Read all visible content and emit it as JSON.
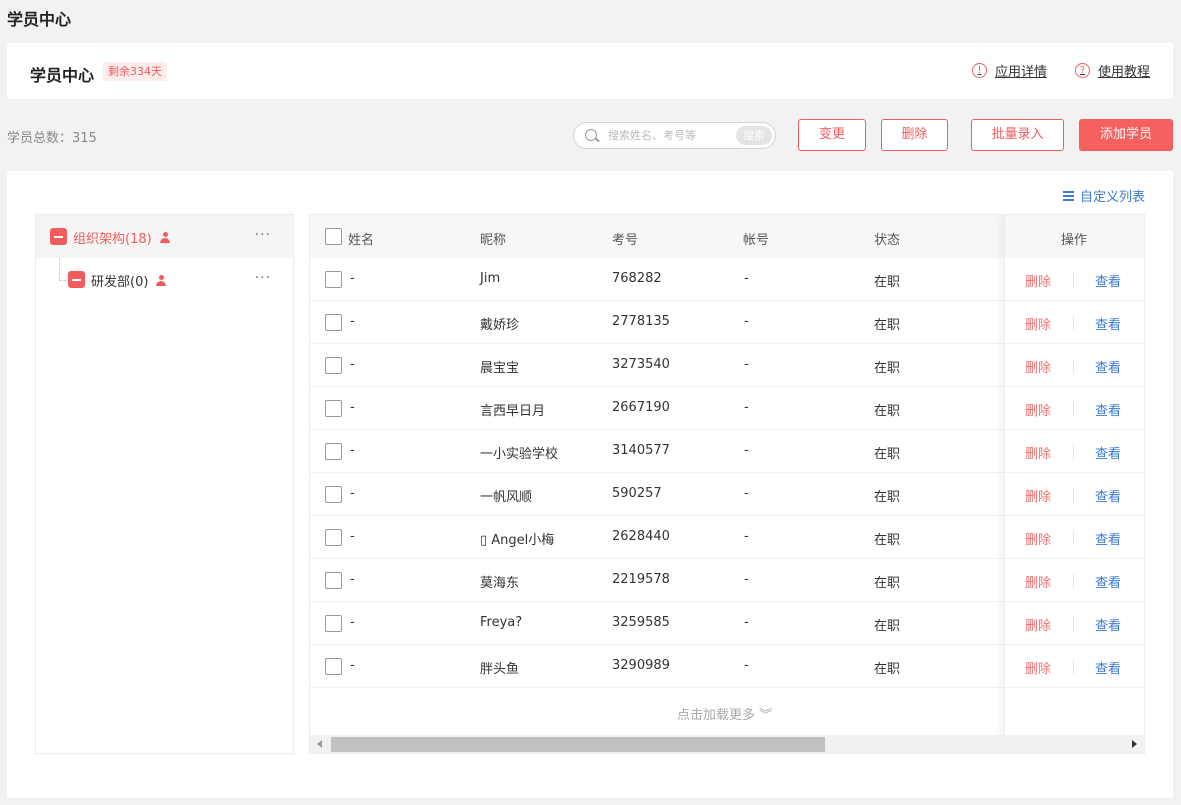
{
  "page": {
    "title": "学员中心"
  },
  "header": {
    "title": "学员中心",
    "remain_badge": "剩余334天",
    "app_detail": "应用详情",
    "tutorial": "使用教程"
  },
  "toolbar": {
    "total_text": "学员总数：315",
    "search_placeholder": "搜索姓名、考号等",
    "search_button": "搜索",
    "change": "变更",
    "delete": "删除",
    "batch_import": "批量录入",
    "add_student": "添加学员"
  },
  "custom_list": "自定义列表",
  "tree": {
    "root_label": "组织架构(18)",
    "child_label": "研发部(0)",
    "more": "···"
  },
  "table": {
    "columns": [
      "姓名",
      "昵称",
      "考号",
      "帐号",
      "状态",
      "操作"
    ],
    "rows": [
      {
        "name": "-",
        "nickname": "Jim",
        "exam_no": "768282",
        "account": "-",
        "status": "在职"
      },
      {
        "name": "-",
        "nickname": "戴娇珍",
        "exam_no": "2778135",
        "account": "-",
        "status": "在职"
      },
      {
        "name": "-",
        "nickname": "晨宝宝",
        "exam_no": "3273540",
        "account": "-",
        "status": "在职"
      },
      {
        "name": "-",
        "nickname": "言西早日月",
        "exam_no": "2667190",
        "account": "-",
        "status": "在职"
      },
      {
        "name": "-",
        "nickname": "一小实验学校",
        "exam_no": "3140577",
        "account": "-",
        "status": "在职"
      },
      {
        "name": "-",
        "nickname": "一帆风顺",
        "exam_no": "590257",
        "account": "-",
        "status": "在职"
      },
      {
        "name": "-",
        "nickname": "\u0000 Angel小梅",
        "exam_no": "2628440",
        "account": "-",
        "status": "在职"
      },
      {
        "name": "-",
        "nickname": "莫海东",
        "exam_no": "2219578",
        "account": "-",
        "status": "在职"
      },
      {
        "name": "-",
        "nickname": "Freya?",
        "exam_no": "3259585",
        "account": "-",
        "status": "在职"
      },
      {
        "name": "-",
        "nickname": "胖头鱼",
        "exam_no": "3290989",
        "account": "-",
        "status": "在职"
      }
    ],
    "op_delete": "删除",
    "op_view": "查看",
    "load_more": "点击加载更多 ︾"
  },
  "colors": {
    "accent": "#f25c5c",
    "link": "#3a7bd5"
  }
}
